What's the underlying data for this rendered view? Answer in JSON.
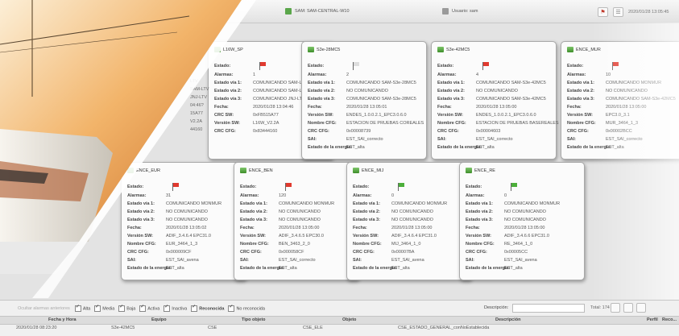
{
  "header": {
    "server": "SAM: SAM-CENTRAL-W10",
    "user": "Usuario: sam",
    "datetime": "2020/01/28 13:05:45"
  },
  "colors": {
    "alarm_red": "#e03a2f",
    "ok_green": "#4caf3a",
    "flag_gray": "#dddddd"
  },
  "labels": {
    "estado": "Estado:",
    "alarmas": "Alarmas:",
    "via1": "Estado vía 1:",
    "via2": "Estado vía 2:",
    "via3": "Estado vía 3:",
    "fecha": "Fecha:",
    "crc_sw": "CRC SW:",
    "version_sw": "Versión SW:",
    "crc_cfg": "CRC CFG:",
    "nombre_cfg": "Nombre CFG:",
    "sai": "SAI:",
    "energia": "Estado de la energía:"
  },
  "cards": [
    {
      "title": "L16W_SP",
      "flag": "red",
      "rows": [
        [
          "alarmas",
          "1"
        ],
        [
          "via1",
          "COMUNICANDO SAM-LTV"
        ],
        [
          "via2",
          "COMUNICANDO SAM-LTV"
        ],
        [
          "via3",
          "COMUNICANDO JNJ-LTV"
        ],
        [
          "fecha",
          "2020/01/28 13:04:46"
        ],
        [
          "crc_sw",
          "0xFB515A77"
        ],
        [
          "version_sw",
          "L16W_V2.2A"
        ],
        [
          "crc_cfg",
          "0x83444160"
        ]
      ]
    },
    {
      "title": "S3e-28MC5",
      "flag": "gray",
      "rows": [
        [
          "alarmas",
          "2"
        ],
        [
          "via1",
          "COMUNICANDO SAM-S3e-28MC5"
        ],
        [
          "via2",
          "NO COMUNICANDO"
        ],
        [
          "via3",
          "COMUNICANDO SAM-S3e-28MC5"
        ],
        [
          "fecha",
          "2020/01/28 13:05:01"
        ],
        [
          "version_sw",
          "ENDES_1.0.0.2.1_EPC3.0.6.0"
        ],
        [
          "nombre_cfg",
          "ESTACION DE PRUEBAS COREALES"
        ],
        [
          "crc_cfg",
          "0x00008739"
        ],
        [
          "sai",
          "EST_SAI_correcto"
        ],
        [
          "energia",
          "EST_alta"
        ]
      ]
    },
    {
      "title": "S3e-42MC5",
      "flag": "red",
      "rows": [
        [
          "alarmas",
          "4"
        ],
        [
          "via1",
          "COMUNICANDO SAM-S3e-42MC5"
        ],
        [
          "via2",
          "NO COMUNICANDO"
        ],
        [
          "via3",
          "COMUNICANDO SAM-S3e-42MC5"
        ],
        [
          "fecha",
          "2020/01/28 13:05:00"
        ],
        [
          "version_sw",
          "ENDES_1.0.0.2.1_EPC3.0.6.0"
        ],
        [
          "nombre_cfg",
          "ESTACION DE PRUEBAS BASEREALES"
        ],
        [
          "crc_cfg",
          "0x00004603"
        ],
        [
          "sai",
          "EST_SAI_correcto"
        ],
        [
          "energia",
          "EST_alta"
        ]
      ]
    },
    {
      "title": "ENCE_MUR",
      "flag": "red",
      "rows": [
        [
          "alarmas",
          "10"
        ],
        [
          "via1",
          "COMUNICANDO MONMUR"
        ],
        [
          "via2",
          "NO COMUNICANDO"
        ],
        [
          "via3",
          "COMUNICANDO SAM-S3e-42MC5"
        ],
        [
          "fecha",
          "2020/01/28 13:05:00"
        ],
        [
          "version_sw",
          "EPC3.0_3.1"
        ],
        [
          "nombre_cfg",
          "MUR_3464_1_3"
        ],
        [
          "crc_cfg",
          "0x00002BCC"
        ],
        [
          "sai",
          "EST_SAI_correcto"
        ],
        [
          "energia",
          "EST_alta"
        ]
      ]
    },
    {
      "title": "ENCE_EUR",
      "flag": "red",
      "rows": [
        [
          "alarmas",
          "31"
        ],
        [
          "via1",
          "COMUNICANDO MONMUR"
        ],
        [
          "via2",
          "NO COMUNICANDO"
        ],
        [
          "via3",
          "NO COMUNICANDO"
        ],
        [
          "fecha",
          "2020/01/28 13:05:02"
        ],
        [
          "version_sw",
          "ADIF_3.4.6.4   EPC31.0"
        ],
        [
          "nombre_cfg",
          "EUR_3464_1_3"
        ],
        [
          "crc_cfg",
          "0x000009CF"
        ],
        [
          "sai",
          "EST_SAI_avena"
        ],
        [
          "energia",
          "EST_alta"
        ]
      ]
    },
    {
      "title": "ENCE_BEN",
      "flag": "red",
      "rows": [
        [
          "alarmas",
          "120"
        ],
        [
          "via1",
          "COMUNICANDO MONMUR"
        ],
        [
          "via2",
          "NO COMUNICANDO"
        ],
        [
          "via3",
          "NO COMUNICANDO"
        ],
        [
          "fecha",
          "2020/01/28 13:05:00"
        ],
        [
          "version_sw",
          "ADIF_3.4.6.5   EPC30.0"
        ],
        [
          "nombre_cfg",
          "BEN_3463_2_0"
        ],
        [
          "crc_cfg",
          "0x000058CF"
        ],
        [
          "sai",
          "EST_SAI_correcto"
        ],
        [
          "energia",
          "EST_alta"
        ]
      ]
    },
    {
      "title": "ENCE_MIJ",
      "flag": "green",
      "rows": [
        [
          "alarmas",
          "0"
        ],
        [
          "via1",
          "COMUNICANDO MONMUR"
        ],
        [
          "via2",
          "NO COMUNICANDO"
        ],
        [
          "via3",
          "NO COMUNICANDO"
        ],
        [
          "fecha",
          "2020/01/28 13:05:00"
        ],
        [
          "version_sw",
          "ADIF_3.4.6.4   EPC31.0"
        ],
        [
          "nombre_cfg",
          "MIJ_3464_1_0"
        ],
        [
          "crc_cfg",
          "0x00007BA"
        ],
        [
          "sai",
          "EST_SAI_avena"
        ],
        [
          "energia",
          "EST_alta"
        ]
      ]
    },
    {
      "title": "ENCE_RE",
      "flag": "green",
      "rows": [
        [
          "alarmas",
          "0"
        ],
        [
          "via1",
          "COMUNICANDO MONMUR"
        ],
        [
          "via2",
          "NO COMUNICANDO"
        ],
        [
          "via3",
          "NO COMUNICANDO"
        ],
        [
          "fecha",
          "2020/01/28 13:05:00"
        ],
        [
          "version_sw",
          "ADIF_3.4.6.6   EPC31.0"
        ],
        [
          "nombre_cfg",
          "RE_3464_1_0"
        ],
        [
          "crc_cfg",
          "0x00005CC"
        ],
        [
          "sai",
          "EST_SAI_avena"
        ],
        [
          "energia",
          "EST_alta"
        ]
      ]
    }
  ],
  "partial_card_fragments": [
    "LTV",
    "SAM-LTV",
    "JNJ-LTV",
    "04:46?",
    "15A77",
    "V2.2A",
    "44160"
  ],
  "filters": {
    "hidden_label": "Ocultar alarmas anteriores",
    "items": [
      {
        "label": "Alta",
        "checked": true
      },
      {
        "label": "Media",
        "checked": true
      },
      {
        "label": "Baja",
        "checked": true
      },
      {
        "label": "Activa",
        "checked": true
      },
      {
        "label": "Inactiva",
        "checked": true
      },
      {
        "label": "Reconocida",
        "checked": true
      },
      {
        "label": "No reconocida",
        "checked": true
      }
    ],
    "description_label": "Descripción:",
    "total": "Total: 174"
  },
  "table": {
    "headers": [
      "Fecha y Hora",
      "Equipo",
      "Tipo objeto",
      "Objeto",
      "Descripción",
      "Perfil",
      "Reco..."
    ],
    "rows": [
      [
        "2020/01/28 08:23:20",
        "S3e-42MC5",
        "CSE",
        "CSE_ELE",
        "CSE_ESTADO_GENERAL_conNoEstablecida",
        "",
        ""
      ]
    ]
  }
}
